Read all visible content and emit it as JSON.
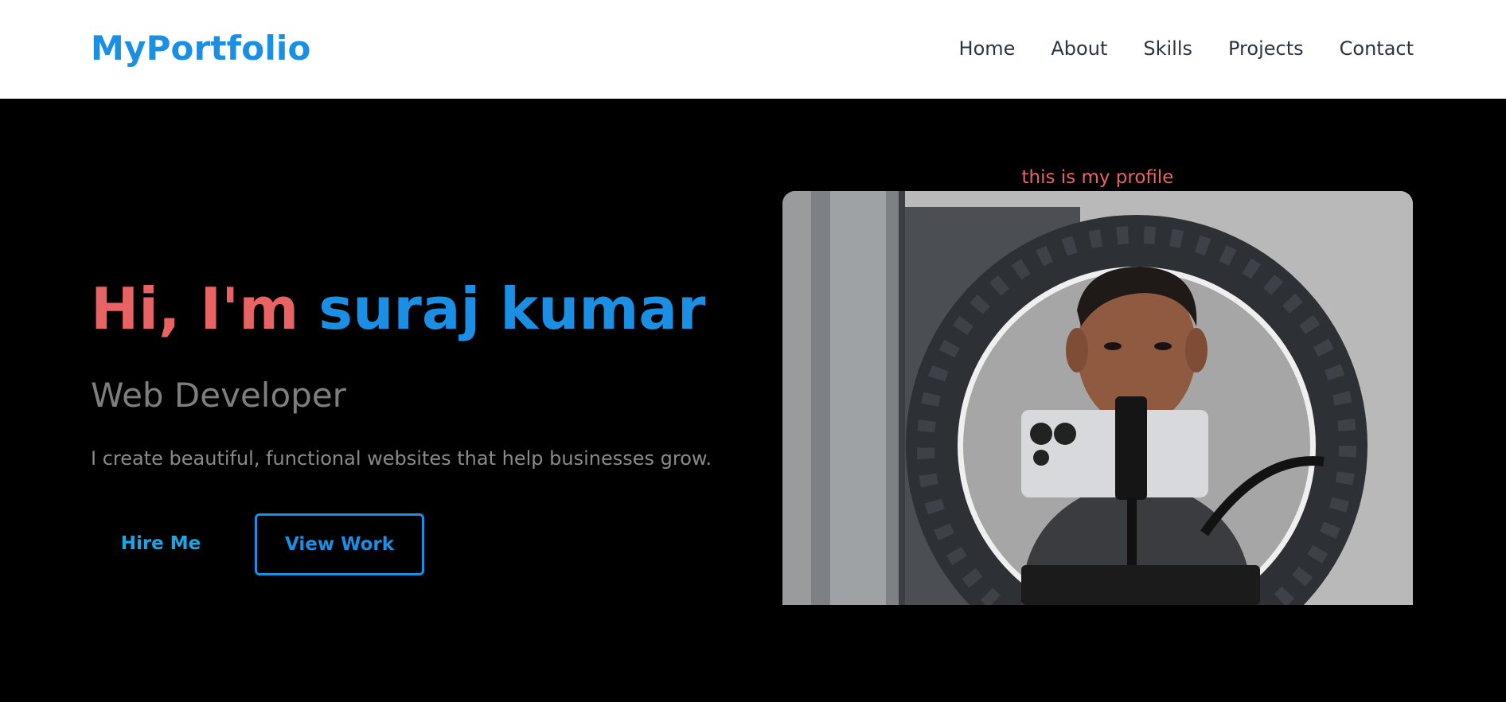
{
  "navbar": {
    "brand": "MyPortfolio",
    "links": [
      "Home",
      "About",
      "Skills",
      "Projects",
      "Contact"
    ]
  },
  "hero": {
    "greeting": "Hi, I'm ",
    "name": "suraj kumar",
    "subtitle": "Web Developer",
    "description": "I create beautiful, functional websites that help businesses grow.",
    "buttons": {
      "hire": "Hire Me",
      "view": "View Work"
    }
  },
  "profile": {
    "caption": "this is my profile"
  },
  "colors": {
    "brand": "#1a8fe3",
    "accent_red": "#e86464",
    "background": "#000000",
    "nav_text": "#2b3442"
  }
}
